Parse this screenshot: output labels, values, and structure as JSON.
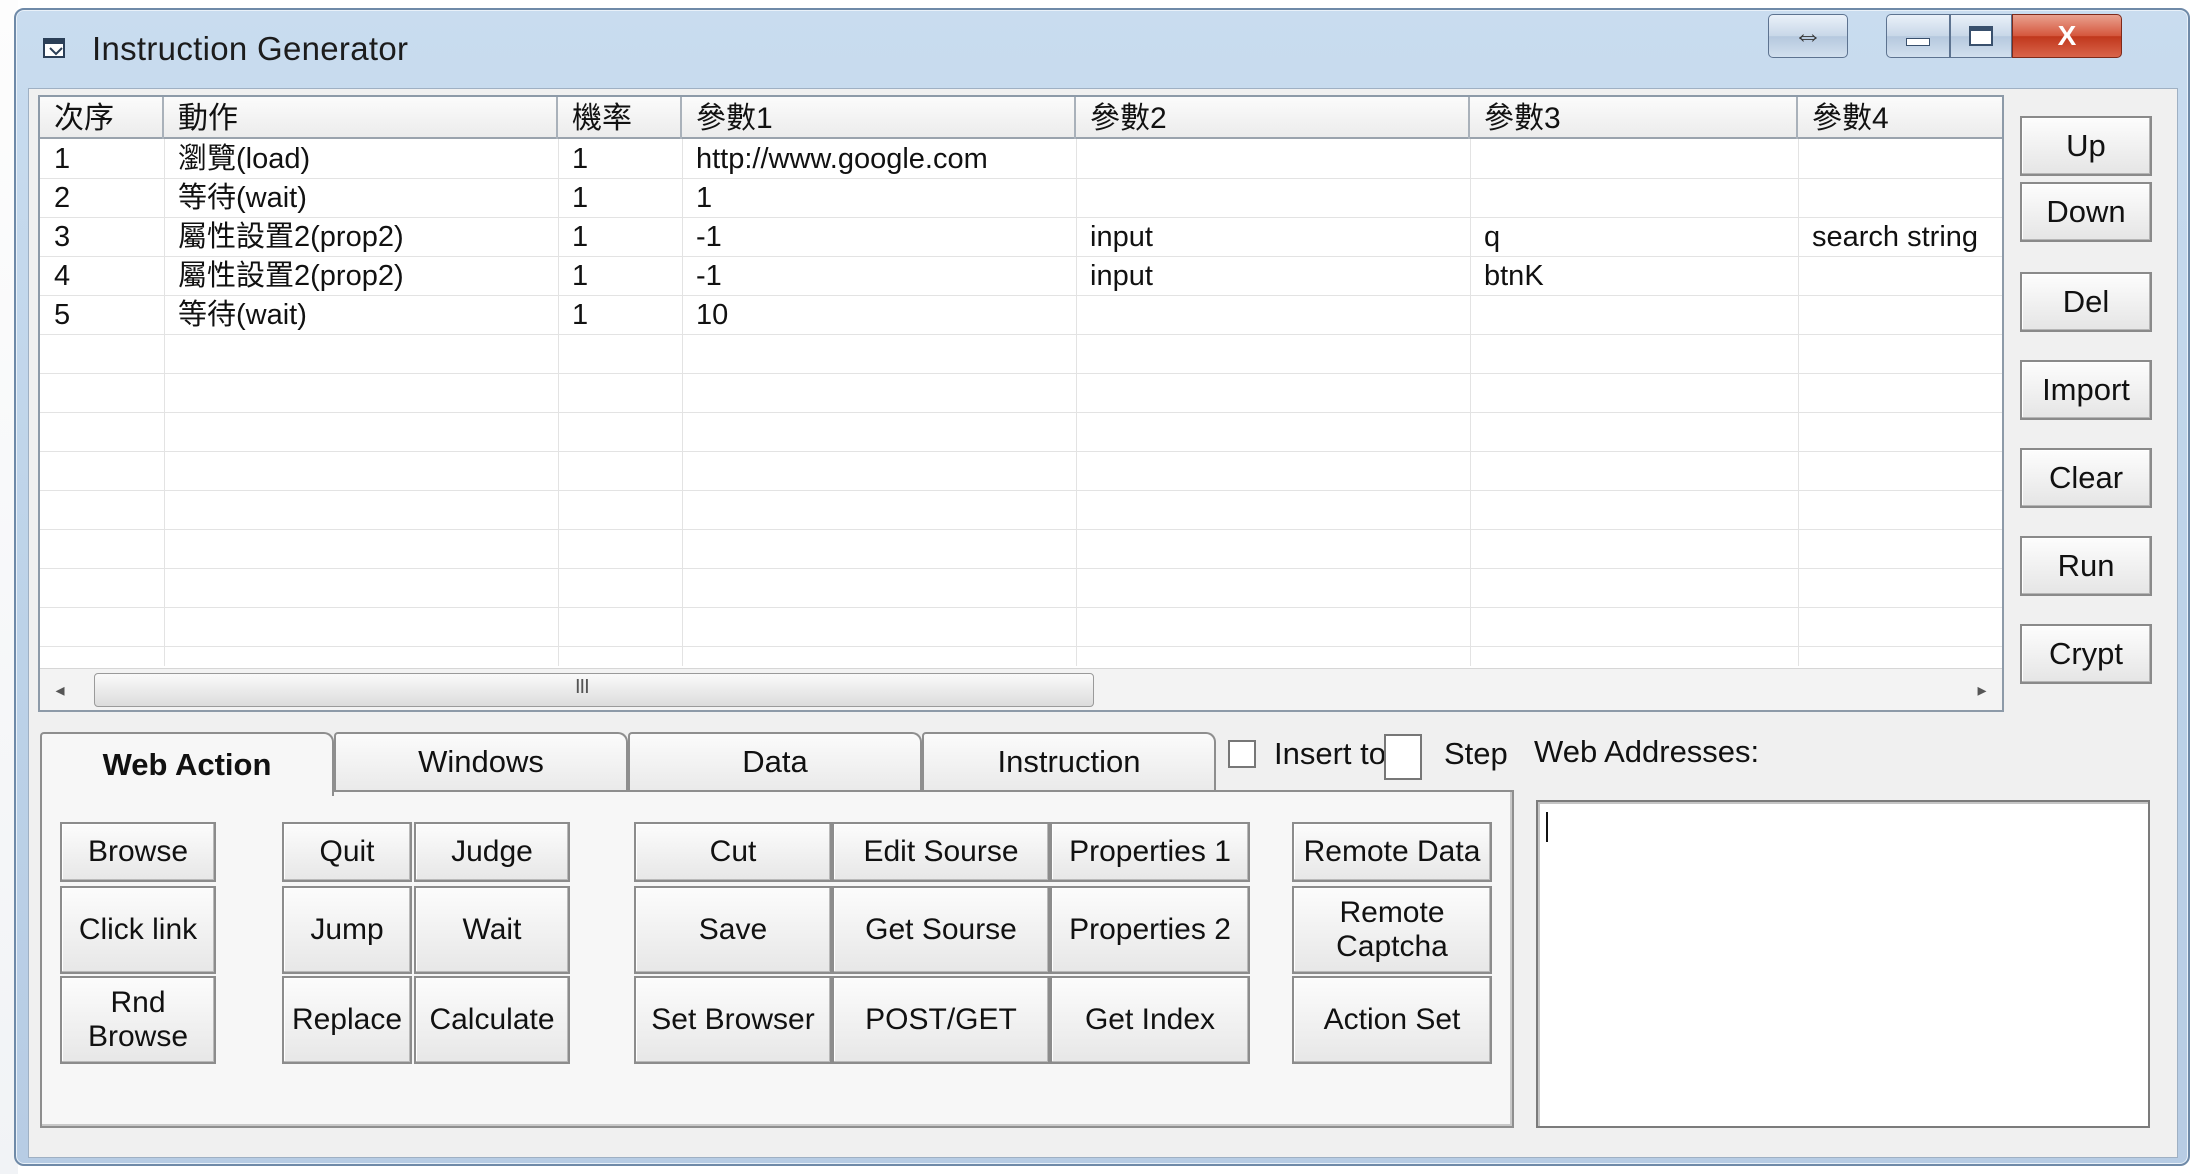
{
  "window": {
    "title": "Instruction Generator"
  },
  "caption_buttons": {
    "resize": "⇔",
    "close": "X"
  },
  "grid": {
    "headers": [
      "次序",
      "動作",
      "機率",
      "參數1",
      "參數2",
      "參數3",
      "參數4"
    ],
    "rows": [
      [
        "1",
        "瀏覽(load)",
        "1",
        "http://www.google.com",
        "",
        "",
        ""
      ],
      [
        "2",
        "等待(wait)",
        "1",
        "1",
        "",
        "",
        ""
      ],
      [
        "3",
        "屬性設置2(prop2)",
        "1",
        "-1",
        "input",
        "q",
        "search string"
      ],
      [
        "4",
        "屬性設置2(prop2)",
        "1",
        "-1",
        "input",
        "btnK",
        ""
      ],
      [
        "5",
        "等待(wait)",
        "1",
        "10",
        "",
        "",
        ""
      ]
    ],
    "scroll_grip": "III",
    "scroll_left": "◂",
    "scroll_right": "▸"
  },
  "side_buttons": [
    "Up",
    "Down",
    "Del",
    "Import",
    "Clear",
    "Run",
    "Crypt"
  ],
  "tabs": [
    "Web Action",
    "Windows",
    "Data",
    "Instruction"
  ],
  "insert_to": {
    "label": "Insert to",
    "checked": false,
    "step_value": ""
  },
  "step_label": "Step",
  "web_addresses": {
    "label": "Web Addresses:",
    "value": ""
  },
  "action_buttons": {
    "browse": "Browse",
    "click_link": "Click link",
    "rnd_browse": "Rnd\nBrowse",
    "quit": "Quit",
    "judge": "Judge",
    "jump": "Jump",
    "wait": "Wait",
    "replace": "Replace",
    "calculate": "Calculate",
    "cut": "Cut",
    "edit_source": "Edit Sourse",
    "properties1": "Properties 1",
    "save": "Save",
    "get_source": "Get Sourse",
    "properties2": "Properties 2",
    "set_browser": "Set Browser",
    "post_get": "POST/GET",
    "get_index": "Get Index",
    "remote_data": "Remote Data",
    "remote_captcha": "Remote\nCaptcha",
    "action_set": "Action Set"
  }
}
